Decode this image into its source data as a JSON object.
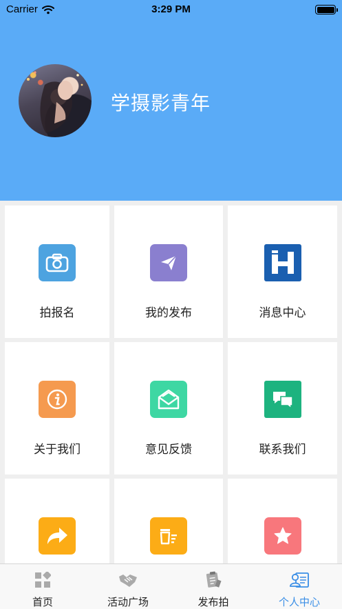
{
  "status_bar": {
    "carrier": "Carrier",
    "time": "3:29 PM"
  },
  "profile": {
    "username": "学摄影青年"
  },
  "grid_items": [
    {
      "label": "拍报名",
      "icon": "camera-icon",
      "color": "#4da3e0"
    },
    {
      "label": "我的发布",
      "icon": "paper-plane-icon",
      "color": "#8a7fcf"
    },
    {
      "label": "消息中心",
      "icon": "h-logo-icon",
      "color": "#1a5fb0"
    },
    {
      "label": "关于我们",
      "icon": "info-icon",
      "color": "#f59a4f"
    },
    {
      "label": "意见反馈",
      "icon": "envelope-icon",
      "color": "#3ed7a3"
    },
    {
      "label": "联系我们",
      "icon": "chat-bubbles-icon",
      "color": "#1db37f"
    },
    {
      "label": "",
      "icon": "share-arrow-icon",
      "color": "#fcac16"
    },
    {
      "label": "",
      "icon": "clear-cache-icon",
      "color": "#fcac16"
    },
    {
      "label": "",
      "icon": "star-icon",
      "color": "#f8777c"
    }
  ],
  "tabbar": {
    "tabs": [
      {
        "label": "首页",
        "icon": "grid-home-icon"
      },
      {
        "label": "活动广场",
        "icon": "handshake-icon"
      },
      {
        "label": "发布拍",
        "icon": "clipboard-icon"
      },
      {
        "label": "个人中心",
        "icon": "profile-card-icon"
      }
    ],
    "active_color": "#3a8ee6"
  }
}
